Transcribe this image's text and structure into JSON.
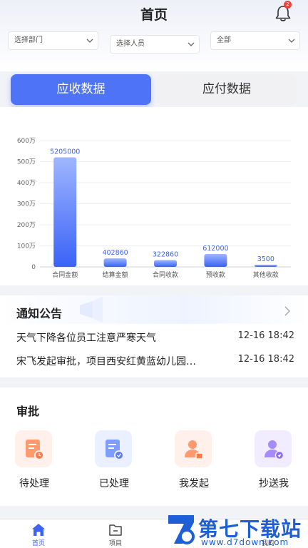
{
  "header": {
    "title": "首页",
    "badge_count": "2"
  },
  "filters": {
    "department": "选择部门",
    "person": "选择人员",
    "scope": "全部"
  },
  "tabs": {
    "receivable": "应收数据",
    "payable": "应付数据"
  },
  "chart_data": {
    "type": "bar",
    "categories": [
      "合同金额",
      "结算金额",
      "合同收款",
      "预收款",
      "其他收款"
    ],
    "values": [
      5205000,
      402860,
      322860,
      612000,
      3500
    ],
    "value_labels": [
      "5205000",
      "402860",
      "322860",
      "612000",
      "3500"
    ],
    "y_ticks": [
      "0",
      "100万",
      "200万",
      "300万",
      "400万",
      "500万",
      "600万"
    ],
    "ylim": [
      0,
      6000000
    ],
    "grid": true,
    "bar_color_top": "#9fb6ff",
    "bar_color_bottom": "#3a62f6"
  },
  "notice": {
    "title": "通知公告",
    "items": [
      {
        "text": "天气下降各位员工注意严寒天气",
        "time": "12-16 18:42"
      },
      {
        "text": "宋飞发起审批，项目西安红黄蓝幼儿园…",
        "time": "12-16 18:42"
      }
    ]
  },
  "approval": {
    "title": "审批",
    "items": [
      {
        "label": "待处理",
        "icon": "pending-doc-icon"
      },
      {
        "label": "已处理",
        "icon": "processed-doc-icon"
      },
      {
        "label": "我发起",
        "icon": "initiator-user-icon"
      },
      {
        "label": "抄送我",
        "icon": "cc-user-icon"
      }
    ]
  },
  "nav": {
    "home": "首页",
    "project": "项目",
    "mine": "我的"
  },
  "watermark": {
    "name": "第七下载站",
    "url": "www.d7down.com"
  },
  "colors": {
    "accent": "#4f73f7",
    "badge": "#f0443c"
  }
}
